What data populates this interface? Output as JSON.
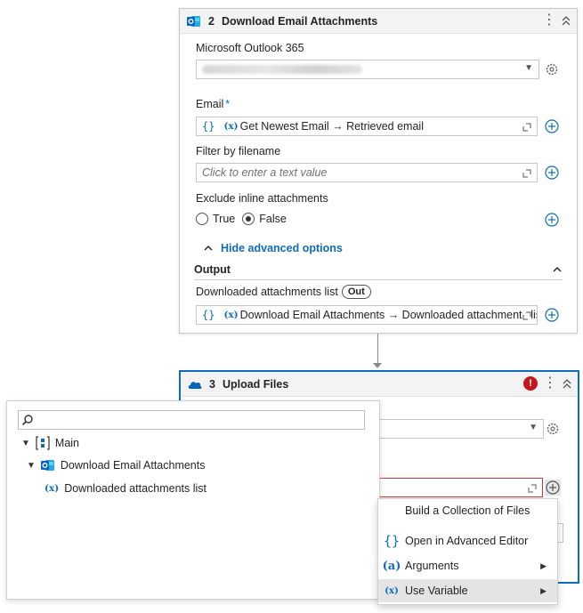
{
  "card1": {
    "step_number": "2",
    "title": "Download Email Attachments",
    "connection_label": "Microsoft Outlook 365",
    "email_label": "Email",
    "email_required": "*",
    "email_value": "Get Newest Email → Retrieved email",
    "filter_label": "Filter by filename",
    "filter_placeholder": "Click to enter a text value",
    "exclude_label": "Exclude inline attachments",
    "radio_true": "True",
    "radio_false": "False",
    "advanced_toggle": "Hide advanced options",
    "output_section": "Output",
    "downloaded_label": "Downloaded attachments list",
    "out_badge": "Out",
    "downloaded_value": "Download Email Attachments → Downloaded attachments lis"
  },
  "card2": {
    "step_number": "3",
    "title": "Upload Files",
    "error_badge": "!"
  },
  "tree": {
    "search_placeholder": "",
    "items": [
      {
        "label": "Main"
      },
      {
        "label": "Download Email Attachments"
      },
      {
        "label": "Downloaded attachments list"
      }
    ]
  },
  "menu": {
    "items": [
      {
        "label": "Build a Collection of Files"
      },
      {
        "label": "Open in Advanced Editor"
      },
      {
        "label": "Arguments"
      },
      {
        "label": "Use Variable"
      }
    ]
  },
  "colors": {
    "accent": "#0f6cbd",
    "error": "#c4161c",
    "outlook_blue": "#0a64c2",
    "onedrive_blue": "#0364b8"
  }
}
